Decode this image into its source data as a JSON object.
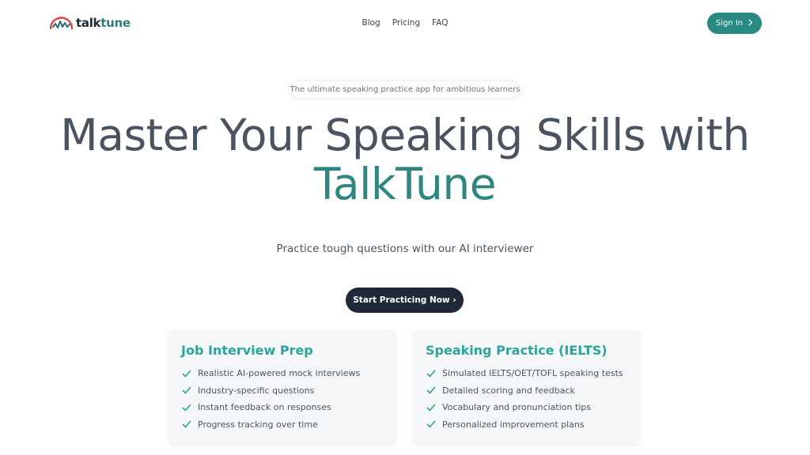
{
  "brand": {
    "name_part1": "talk",
    "name_part2": "tune",
    "logo_icon": "sound-wave-arc-icon",
    "accent_color": "#2a8a82"
  },
  "nav": {
    "links": [
      "Blog",
      "Pricing",
      "FAQ"
    ],
    "signin_label": "Sign In",
    "signin_icon": "chevron-right-icon"
  },
  "hero": {
    "tagline": "The ultimate speaking practice app for ambitious learners",
    "title_line1": "Master Your Speaking Skills with",
    "title_brand": "TalkTune",
    "subtitle": "Practice tough questions with our AI interviewer",
    "cta_label": "Start Practicing Now ›"
  },
  "cards": [
    {
      "title": "Job Interview Prep",
      "features": [
        "Realistic AI-powered mock interviews",
        "Industry-specific questions",
        "Instant feedback on responses",
        "Progress tracking over time"
      ]
    },
    {
      "title": "Speaking Practice (IELTS)",
      "features": [
        "Simulated IELTS/OET/TOFL speaking tests",
        "Detailed scoring and feedback",
        "Vocabulary and pronunciation tips",
        "Personalized improvement plans"
      ]
    }
  ],
  "colors": {
    "title_brand": "#2f8580",
    "card_title": "#2aa59a",
    "cta_bg": "#1f2937",
    "check": "#2aa59a"
  }
}
